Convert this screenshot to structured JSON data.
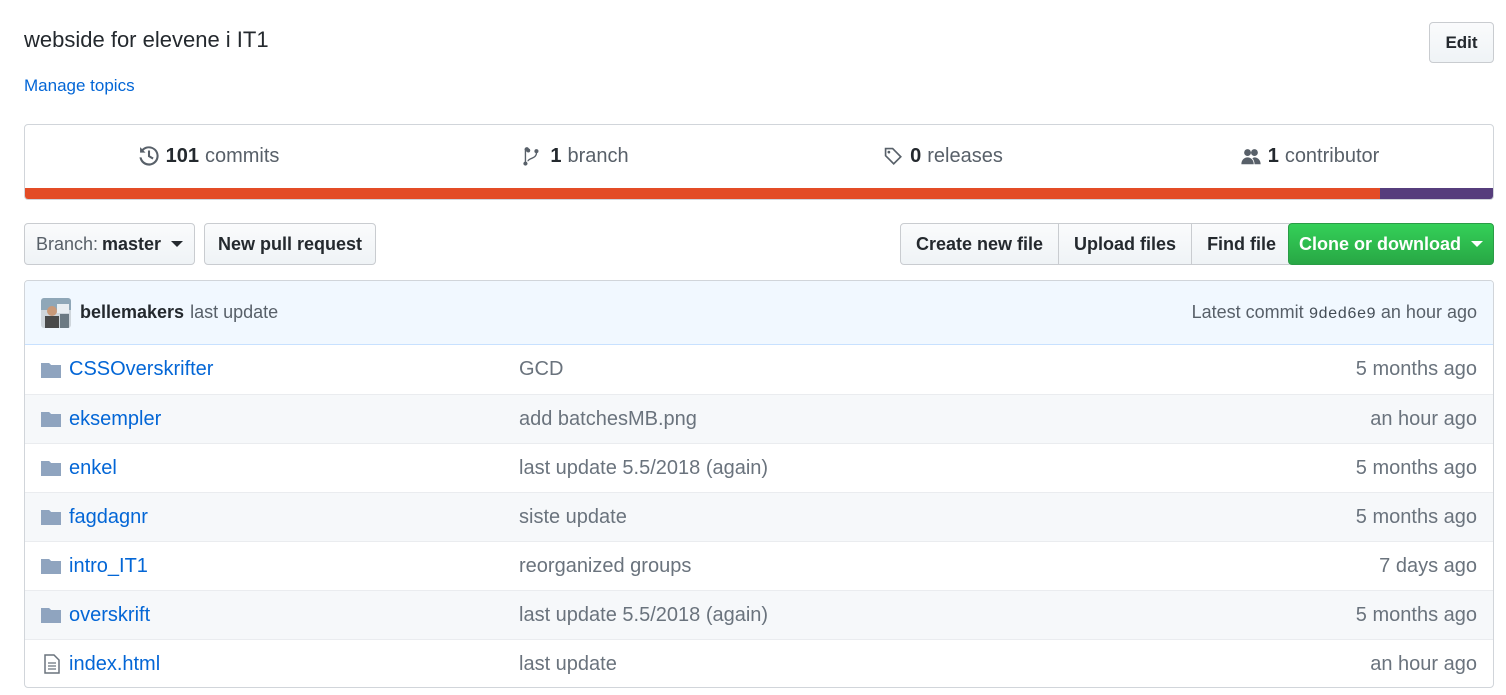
{
  "repo": {
    "description": "webside for elevene i IT1",
    "manage_topics": "Manage topics",
    "edit_label": "Edit"
  },
  "summary": {
    "commits_count": "101",
    "commits_label": "commits",
    "branch_count": "1",
    "branch_label": "branch",
    "releases_count": "0",
    "releases_label": "releases",
    "contributor_count": "1",
    "contributor_label": "contributor",
    "languages": [
      {
        "color": "#e34c26",
        "percent": 92.3
      },
      {
        "color": "#563d7c",
        "percent": 7.7
      }
    ]
  },
  "toolbar": {
    "branch_prefix": "Branch:",
    "branch_name": "master",
    "new_pr": "New pull request",
    "create_file": "Create new file",
    "upload_files": "Upload files",
    "find_file": "Find file",
    "clone": "Clone or download"
  },
  "commit_tease": {
    "author": "bellemakers",
    "message": "last update",
    "latest_label": "Latest commit",
    "sha": "9ded6e9",
    "age": "an hour ago"
  },
  "files": [
    {
      "type": "folder",
      "name": "CSSOverskrifter",
      "message": "GCD",
      "age": "5 months ago"
    },
    {
      "type": "folder",
      "name": "eksempler",
      "message": "add batchesMB.png",
      "age": "an hour ago"
    },
    {
      "type": "folder",
      "name": "enkel",
      "message": "last update 5.5/2018 (again)",
      "age": "5 months ago"
    },
    {
      "type": "folder",
      "name": "fagdagnr",
      "message": "siste update",
      "age": "5 months ago"
    },
    {
      "type": "folder",
      "name": "intro_IT1",
      "message": "reorganized groups",
      "age": "7 days ago"
    },
    {
      "type": "folder",
      "name": "overskrift",
      "message": "last update 5.5/2018 (again)",
      "age": "5 months ago"
    },
    {
      "type": "file",
      "name": "index.html",
      "message": "last update",
      "age": "an hour ago"
    }
  ]
}
